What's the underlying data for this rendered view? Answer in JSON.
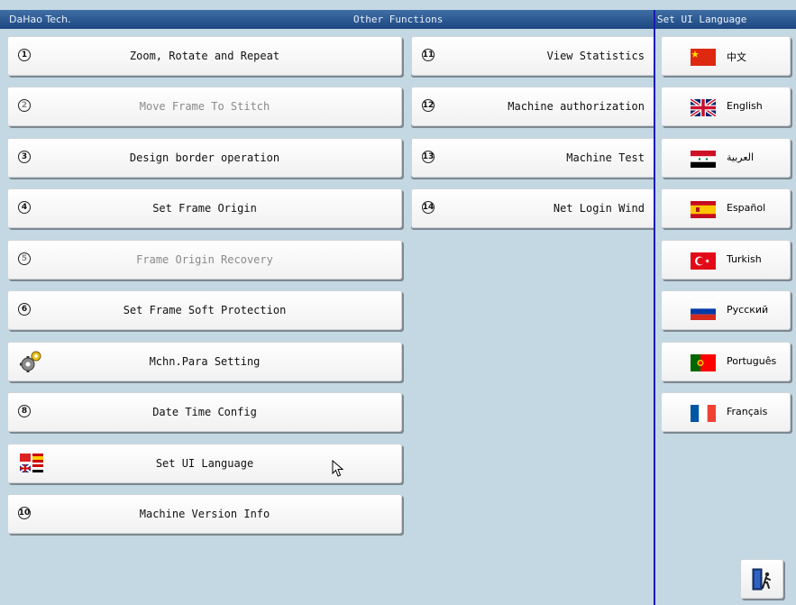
{
  "titlebar": {
    "brand": "DaHao Tech.",
    "title": "Other Functions"
  },
  "left_buttons": [
    {
      "num": "1",
      "label": "Zoom, Rotate and Repeat",
      "disabled": false
    },
    {
      "num": "2",
      "label": "Move Frame To Stitch",
      "disabled": true
    },
    {
      "num": "3",
      "label": "Design border operation",
      "disabled": false
    },
    {
      "num": "4",
      "label": "Set Frame Origin",
      "disabled": false
    },
    {
      "num": "5",
      "label": "Frame Origin Recovery",
      "disabled": true
    },
    {
      "num": "6",
      "label": "Set Frame Soft Protection",
      "disabled": false
    },
    {
      "num": "",
      "icon": "gear-icon",
      "label": "Mchn.Para Setting",
      "disabled": false
    },
    {
      "num": "8",
      "label": "Date Time Config",
      "disabled": false
    },
    {
      "num": "",
      "icon": "flags-icon",
      "label": "Set UI Language",
      "disabled": false
    },
    {
      "num": "10",
      "label": "Machine Version Info",
      "disabled": false
    }
  ],
  "right_buttons": [
    {
      "num": "11",
      "label": "View Statistics"
    },
    {
      "num": "12",
      "label": "Machine authorization"
    },
    {
      "num": "13",
      "label": "Machine Test"
    },
    {
      "num": "14",
      "label": "Net Login Wind"
    }
  ],
  "language_panel": {
    "title": "Set UI Language",
    "languages": [
      {
        "name": "中文",
        "flag": "china-flag-icon"
      },
      {
        "name": "English",
        "flag": "uk-flag-icon"
      },
      {
        "name": "العربية",
        "flag": "syria-flag-icon"
      },
      {
        "name": "Español",
        "flag": "spain-flag-icon"
      },
      {
        "name": "Turkish",
        "flag": "turkey-flag-icon"
      },
      {
        "name": "Русский",
        "flag": "russia-flag-icon"
      },
      {
        "name": "Português",
        "flag": "portugal-flag-icon"
      },
      {
        "name": "Français",
        "flag": "france-flag-icon"
      }
    ],
    "exit_icon": "exit-door-icon"
  },
  "colors": {
    "titlebar": "#1c4680",
    "background": "#c3d8e3",
    "panel_border": "#1a1ab8"
  }
}
